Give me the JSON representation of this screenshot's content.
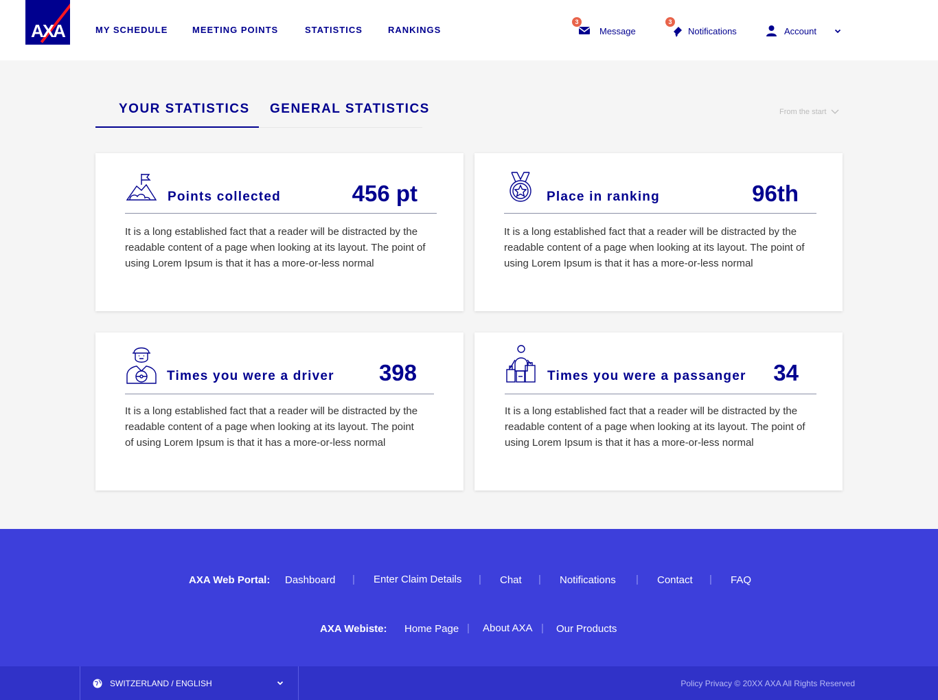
{
  "brand": {
    "logo_text": "AXA"
  },
  "nav": {
    "items": [
      "MY SCHEDULE",
      "MEETING POINTS",
      "STATISTICS",
      "RANKINGS"
    ]
  },
  "header_actions": {
    "message": {
      "label": "Message",
      "badge": "3"
    },
    "notifications": {
      "label": "Notifications",
      "badge": "3"
    },
    "account": {
      "label": "Account"
    }
  },
  "tabs": [
    {
      "label": "YOUR STATISTICS",
      "active": true
    },
    {
      "label": "GENERAL STATISTICS",
      "active": false
    }
  ],
  "period_filter": {
    "value": "From the start"
  },
  "cards": [
    {
      "icon": "flag-mountain-icon",
      "title": "Points collected",
      "value": "456 pt",
      "description": "It is a long established fact that a reader will be distracted by the readable content of a page when looking at its layout. The point of using Lorem Ipsum is that it has a more-or-less normal"
    },
    {
      "icon": "medal-icon",
      "title": "Place in ranking",
      "value": "96th",
      "description": "It is a long established fact that a reader will be distracted by the readable content of a page when looking at its layout. The point of using Lorem Ipsum is that it has a more-or-less normal"
    },
    {
      "icon": "driver-icon",
      "title": "Times you were a driver",
      "value": "398",
      "description": "It is a long established fact that a reader will be distracted by the readable content of a page when looking at its layout. The point of using Lorem Ipsum is that it has a more-or-less normal"
    },
    {
      "icon": "passenger-luggage-icon",
      "title": "Times you were a passanger",
      "value": "34",
      "description": "It is a long established fact that a reader will be distracted by the readable content of a page when looking at its layout. The point of using Lorem Ipsum is that it has a more-or-less normal"
    }
  ],
  "footer": {
    "portal_label": "AXA Web Portal:",
    "portal_links": [
      "Dashboard",
      "Enter Claim Details",
      "Chat",
      "Notifications",
      "Contact",
      "FAQ"
    ],
    "website_label": "AXA Webiste:",
    "website_links": [
      "Home Page",
      "About AXA",
      "Our Products"
    ],
    "separator": "|",
    "language": "SWITZERLAND / ENGLISH",
    "legal": "Policy Privacy  © 20XX AXA All Rights Reserved"
  },
  "colors": {
    "brand_blue": "#00008f",
    "brand_red": "#ff1721",
    "footer_blue": "#3d3fdb",
    "bottom_bar": "#3032c8",
    "badge": "#e8634a"
  }
}
